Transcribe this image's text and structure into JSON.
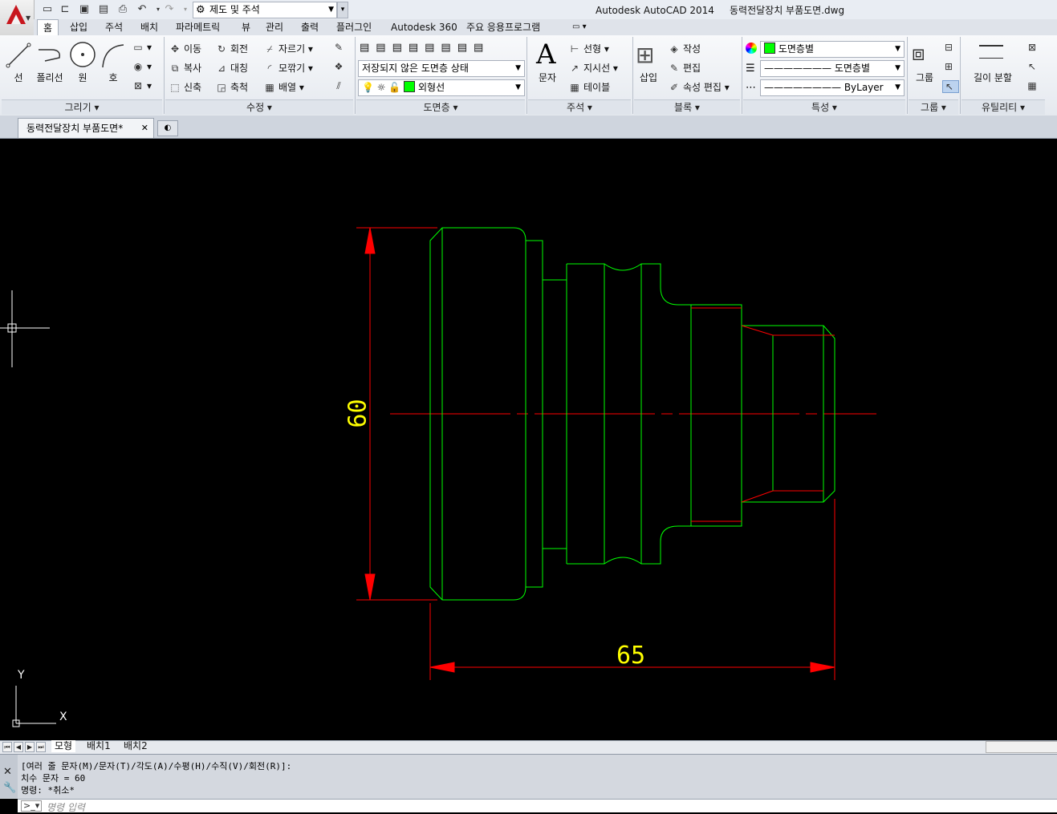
{
  "title_bar": {
    "app_name": "Autodesk AutoCAD 2014",
    "file_name": "동력전달장치 부품도면.dwg",
    "workspace": "제도 및 주석"
  },
  "ribbon_tabs": [
    "홈",
    "삽입",
    "주석",
    "배치",
    "파라메트릭",
    "뷰",
    "관리",
    "출력",
    "플러그인",
    "Autodesk 360",
    "주요 응용프로그램"
  ],
  "draw_panel": {
    "title": "그리기 ▾",
    "tools": [
      "선",
      "폴리선",
      "원",
      "호"
    ]
  },
  "modify_panel": {
    "title": "수정 ▾",
    "row1": [
      "이동",
      "회전",
      "자르기 ▾"
    ],
    "row2": [
      "복사",
      "대칭",
      "모깎기 ▾"
    ],
    "row3": [
      "신축",
      "축척",
      "배열 ▾"
    ]
  },
  "layer_panel": {
    "title": "도면층 ▾",
    "state_combo": "저장되지 않은 도면층 상태",
    "layer_combo": "외형선"
  },
  "annotation_panel": {
    "title": "주석 ▾",
    "big": "문자",
    "items": [
      "선형 ▾",
      "지시선 ▾",
      "테이블"
    ]
  },
  "block_panel": {
    "title": "블록 ▾",
    "big": "삽입",
    "items": [
      "작성",
      "편집",
      "속성 편집 ▾"
    ]
  },
  "properties_panel": {
    "title": "특성 ▾",
    "color": "도면층별",
    "linetype": "도면층별",
    "lineweight": "ByLayer"
  },
  "groups_panel": {
    "title": "그룹 ▾",
    "big": "그룹"
  },
  "utilities_panel": {
    "title": "유틸리티 ▾",
    "big": "길이 분할"
  },
  "document_tab": "동력전달장치 부품도면*",
  "drawing": {
    "dim_vertical": "60",
    "dim_horizontal": "65",
    "ucs_y": "Y",
    "ucs_x": "X"
  },
  "layout_tabs": [
    "모형",
    "배치1",
    "배치2"
  ],
  "command_history": [
    "[여러 줄 문자(M)/문자(T)/각도(A)/수평(H)/수직(V)/회전(R)]:",
    "치수 문자 = 60",
    "명령: *취소*"
  ],
  "command_placeholder": "명령 입력",
  "colors": {
    "outline": "#00ff00",
    "center_hidden": "#ff0000",
    "dimension_text": "#ffff00",
    "canvas": "#000000"
  }
}
